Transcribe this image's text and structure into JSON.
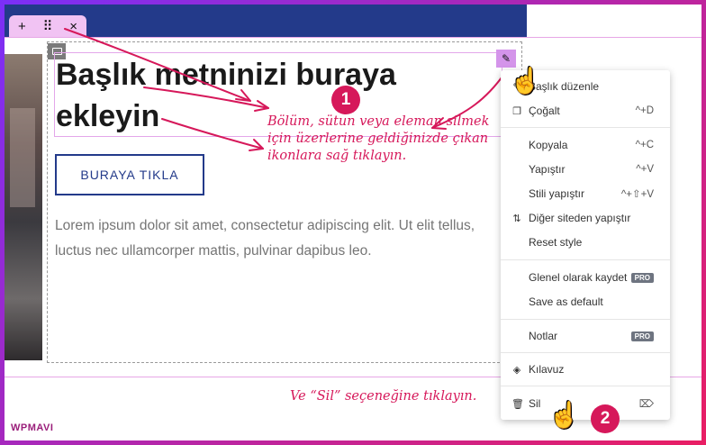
{
  "section_toolbar": {
    "add": "+",
    "move": "⠿",
    "close": "×"
  },
  "heading": "Başlık metninizi buraya ekleyin",
  "button_label": "BURAYA TIKLA",
  "paragraph": "Lorem ipsum dolor sit amet, consectetur adipiscing elit. Ut elit tellus, luctus nec ullamcorper mattis, pulvinar dapibus leo.",
  "annotations": {
    "step1": "Bölüm, sütun veya eleman silmek için üzerlerine geldiğinizde çıkan ikonlara sağ tıklayın.",
    "step2": "Ve “Sil” seçeneğine tıklayın.",
    "badge1": "1",
    "badge2": "2"
  },
  "context_menu": {
    "edit_heading": "Başlık düzenle",
    "duplicate": {
      "label": "Çoğalt",
      "shortcut": "^+D"
    },
    "copy": {
      "label": "Kopyala",
      "shortcut": "^+C"
    },
    "paste": {
      "label": "Yapıştır",
      "shortcut": "^+V"
    },
    "paste_style": {
      "label": "Stili yapıştır",
      "shortcut": "^+⇧+V"
    },
    "paste_other_site": {
      "label": "Diğer siteden yapıştır"
    },
    "reset_style": {
      "label": "Reset style"
    },
    "save_global": {
      "label": "Glenel olarak kaydet",
      "badge": "PRO"
    },
    "save_default": {
      "label": "Save as default"
    },
    "notes": {
      "label": "Notlar",
      "badge": "PRO"
    },
    "navigator": {
      "label": "Kılavuz"
    },
    "delete": {
      "label": "Sil",
      "shortcut": "⌦"
    }
  },
  "brand": "WPMAVI",
  "colors": {
    "accent": "#d6185a",
    "topbar": "#233a8a",
    "editor_pink": "#f1c3f3"
  }
}
